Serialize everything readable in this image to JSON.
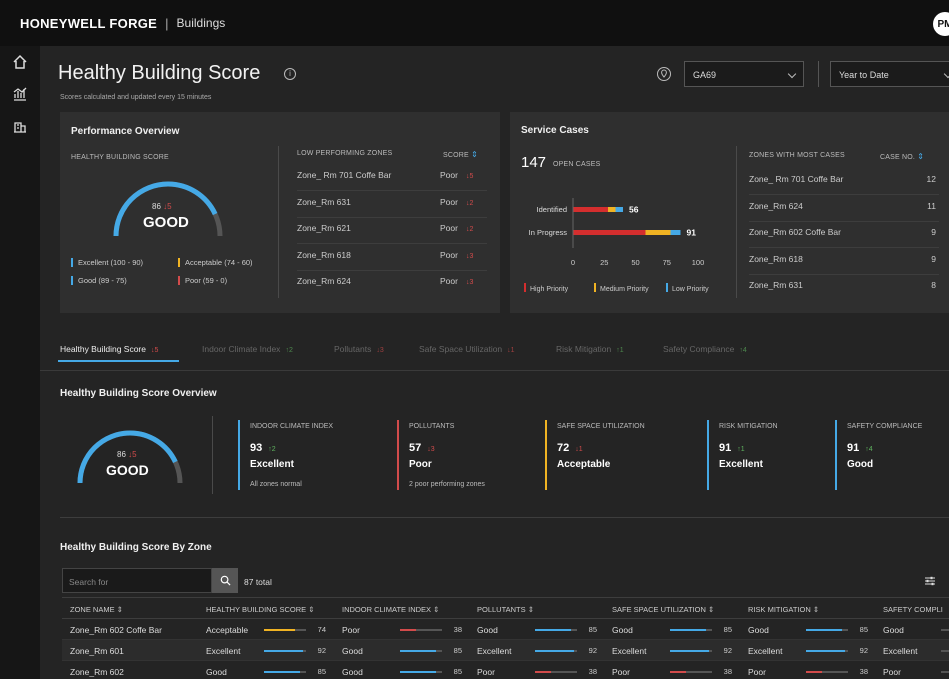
{
  "header": {
    "brand": "HONEYWELL FORGE",
    "separator": "|",
    "product": "Buildings",
    "avatar": "PM"
  },
  "sidebar": {
    "icons": [
      "home-icon",
      "analytics-icon",
      "building-icon"
    ]
  },
  "page": {
    "title": "Healthy Building Score",
    "subtitle": "Scores calculated and updated every 15 minutes",
    "site_select": "GA69",
    "period_select": "Year to Date"
  },
  "performance": {
    "title": "Performance Overview",
    "hbs_label": "HEALTHY BUILDING SCORE",
    "gauge": {
      "value": 86,
      "delta": "↓5",
      "status": "GOOD",
      "fraction": 0.86
    },
    "legend": [
      {
        "label": "Excellent (100 - 90)",
        "color": "#45a9e6"
      },
      {
        "label": "Acceptable (74 - 60)",
        "color": "#f0b323"
      },
      {
        "label": "Good (89 - 75)",
        "color": "#45a9e6"
      },
      {
        "label": "Poor (59 - 0)",
        "color": "#d24b4b"
      }
    ],
    "zones_header": "LOW PERFORMING ZONES",
    "score_header": "SCORE",
    "zones": [
      {
        "name": "Zone_ Rm 701 Coffe Bar",
        "score": "Poor",
        "delta": "↓5"
      },
      {
        "name": "Zone_Rm 631",
        "score": "Poor",
        "delta": "↓2"
      },
      {
        "name": "Zone_Rm 621",
        "score": "Poor",
        "delta": "↓2"
      },
      {
        "name": "Zone_Rm 618",
        "score": "Poor",
        "delta": "↓3"
      },
      {
        "name": "Zone_Rm 624",
        "score": "Poor",
        "delta": "↓3"
      }
    ]
  },
  "service": {
    "title": "Service Cases",
    "open_count": "147",
    "open_label": "OPEN CASES",
    "bars": [
      {
        "label": "Identified",
        "total": "56",
        "high": 28,
        "medium": 6,
        "low": 6
      },
      {
        "label": "In Progress",
        "total": "91",
        "high": 58,
        "medium": 20,
        "low": 8
      }
    ],
    "axis": [
      "0",
      "25",
      "50",
      "75",
      "100"
    ],
    "axis_max": 100,
    "legend": [
      {
        "label": "High Priority",
        "color": "#d42e2e"
      },
      {
        "label": "Medium Priority",
        "color": "#f0b323"
      },
      {
        "label": "Low Priority",
        "color": "#45a9e6"
      }
    ],
    "zones_header": "ZONES WITH MOST CASES",
    "case_header": "CASE NO.",
    "zones": [
      {
        "name": "Zone_ Rm 701 Coffe Bar",
        "cases": "12"
      },
      {
        "name": "Zone_Rm 624",
        "cases": "11"
      },
      {
        "name": "Zone_Rm 602 Coffe Bar",
        "cases": "9"
      },
      {
        "name": "Zone_Rm 618",
        "cases": "9"
      },
      {
        "name": "Zone_Rm 631",
        "cases": "8"
      }
    ]
  },
  "tabs": [
    {
      "label": "Healthy Building Score",
      "delta": "↓5",
      "dir": "down"
    },
    {
      "label": "Indoor Climate Index",
      "delta": "↑2",
      "dir": "up"
    },
    {
      "label": "Pollutants",
      "delta": "↓3",
      "dir": "down"
    },
    {
      "label": "Safe Space Utilization",
      "delta": "↓1",
      "dir": "down"
    },
    {
      "label": "Risk Mitigation",
      "delta": "↑1",
      "dir": "up"
    },
    {
      "label": "Safety Compliance",
      "delta": "↑4",
      "dir": "up"
    }
  ],
  "overview": {
    "title": "Healthy Building Score Overview",
    "gauge": {
      "value": 86,
      "delta": "↓5",
      "status": "GOOD",
      "fraction": 0.86
    },
    "kpis": [
      {
        "title": "INDOOR CLIMATE INDEX",
        "value": "93",
        "delta": "↑2",
        "dir": "up",
        "status": "Excellent",
        "note": "All zones normal",
        "color": "#45a9e6"
      },
      {
        "title": "POLLUTANTS",
        "value": "57",
        "delta": "↓3",
        "dir": "down",
        "status": "Poor",
        "note": "2 poor performing zones",
        "color": "#d24b4b"
      },
      {
        "title": "SAFE SPACE UTILIZATION",
        "value": "72",
        "delta": "↓1",
        "dir": "down",
        "status": "Acceptable",
        "note": "",
        "color": "#f0b323"
      },
      {
        "title": "RISK MITIGATION",
        "value": "91",
        "delta": "↑1",
        "dir": "up",
        "status": "Excellent",
        "note": "",
        "color": "#45a9e6"
      },
      {
        "title": "SAFETY COMPLIANCE",
        "value": "91",
        "delta": "↑4",
        "dir": "up",
        "status": "Good",
        "note": "",
        "color": "#45a9e6"
      }
    ]
  },
  "by_zone": {
    "title": "Healthy Building Score By Zone",
    "search_placeholder": "Search for",
    "total": "87 total",
    "columns": [
      "ZONE NAME",
      "HEALTHY BUILDING SCORE",
      "INDOOR CLIMATE INDEX",
      "POLLUTANTS",
      "SAFE SPACE UTILIZATION",
      "RISK MITIGATION",
      "SAFETY COMPLI"
    ],
    "rows": [
      {
        "zone": "Zone_Rm 602 Coffe Bar",
        "cells": [
          {
            "status": "Acceptable",
            "value": "74",
            "color": "#f0b323"
          },
          {
            "status": "Poor",
            "value": "38",
            "color": "#d24b4b"
          },
          {
            "status": "Good",
            "value": "85",
            "color": "#45a9e6"
          },
          {
            "status": "Good",
            "value": "85",
            "color": "#45a9e6"
          },
          {
            "status": "Good",
            "value": "85",
            "color": "#45a9e6"
          },
          {
            "status": "Good",
            "value": "",
            "color": "#45a9e6"
          }
        ]
      },
      {
        "zone": "Zone_Rm 601",
        "cells": [
          {
            "status": "Excellent",
            "value": "92",
            "color": "#45a9e6"
          },
          {
            "status": "Good",
            "value": "85",
            "color": "#45a9e6"
          },
          {
            "status": "Excellent",
            "value": "92",
            "color": "#45a9e6"
          },
          {
            "status": "Excellent",
            "value": "92",
            "color": "#45a9e6"
          },
          {
            "status": "Excellent",
            "value": "92",
            "color": "#45a9e6"
          },
          {
            "status": "Excellent",
            "value": "",
            "color": "#45a9e6"
          }
        ]
      },
      {
        "zone": "Zone_Rm 602",
        "cells": [
          {
            "status": "Good",
            "value": "85",
            "color": "#45a9e6"
          },
          {
            "status": "Good",
            "value": "85",
            "color": "#45a9e6"
          },
          {
            "status": "Poor",
            "value": "38",
            "color": "#d24b4b"
          },
          {
            "status": "Poor",
            "value": "38",
            "color": "#d24b4b"
          },
          {
            "status": "Poor",
            "value": "38",
            "color": "#d24b4b"
          },
          {
            "status": "Poor",
            "value": "",
            "color": "#d24b4b"
          }
        ]
      }
    ]
  }
}
